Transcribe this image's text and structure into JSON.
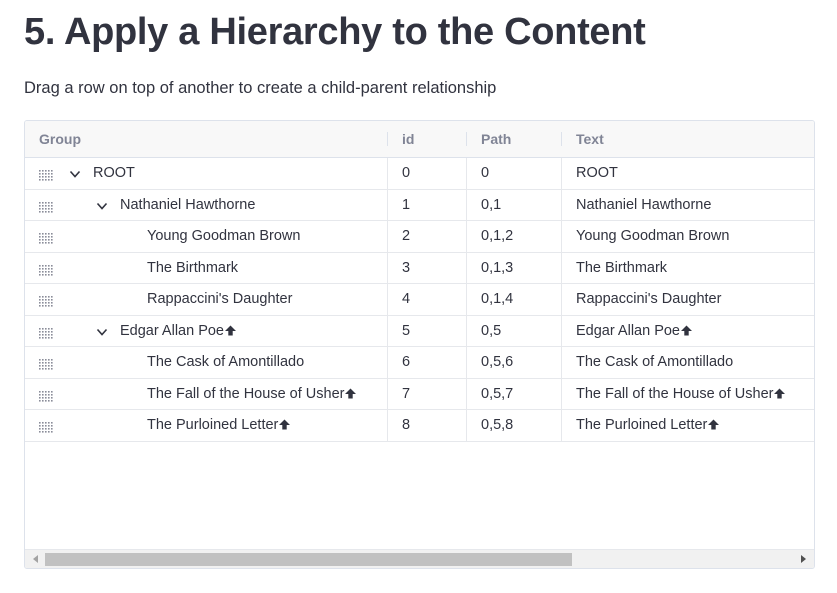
{
  "page": {
    "title": "5. Apply a Hierarchy to the Content",
    "subtitle": "Drag a row on top of another to create a child-parent relationship"
  },
  "grid": {
    "columns": [
      "Group",
      "id",
      "Path",
      "Text"
    ],
    "rows": [
      {
        "group": "ROOT",
        "id": "0",
        "path": "0",
        "text": "ROOT",
        "level": 0,
        "expandable": true,
        "arrow": false
      },
      {
        "group": "Nathaniel Hawthorne",
        "id": "1",
        "path": "0,1",
        "text": "Nathaniel Hawthorne",
        "level": 1,
        "expandable": true,
        "arrow": false
      },
      {
        "group": "Young Goodman Brown",
        "id": "2",
        "path": "0,1,2",
        "text": "Young Goodman Brown",
        "level": 2,
        "expandable": false,
        "arrow": false
      },
      {
        "group": "The Birthmark",
        "id": "3",
        "path": "0,1,3",
        "text": "The Birthmark",
        "level": 2,
        "expandable": false,
        "arrow": false
      },
      {
        "group": "Rappaccini's Daughter",
        "id": "4",
        "path": "0,1,4",
        "text": "Rappaccini's Daughter",
        "level": 2,
        "expandable": false,
        "arrow": false
      },
      {
        "group": "Edgar Allan Poe",
        "id": "5",
        "path": "0,5",
        "text": "Edgar Allan Poe",
        "level": 1,
        "expandable": true,
        "arrow": true
      },
      {
        "group": "The Cask of Amontillado",
        "id": "6",
        "path": "0,5,6",
        "text": "The Cask of Amontillado",
        "level": 2,
        "expandable": false,
        "arrow": false
      },
      {
        "group": "The Fall of the House of Usher",
        "id": "7",
        "path": "0,5,7",
        "text": "The Fall of the House of Usher",
        "level": 2,
        "expandable": false,
        "arrow": true
      },
      {
        "group": "The Purloined Letter",
        "id": "8",
        "path": "0,5,8",
        "text": "The Purloined Letter",
        "level": 2,
        "expandable": false,
        "arrow": true
      }
    ],
    "icons": {
      "drag": "drag-handle-icon",
      "expand": "chevron-down-icon",
      "marker": "arrow-up-icon",
      "scroll_left": "scroll-left-icon",
      "scroll_right": "scroll-right-icon"
    }
  },
  "colors": {
    "text": "#31333f",
    "header_text": "#808495",
    "border": "#dde2eb",
    "scroll_thumb": "#c1c1c1"
  }
}
